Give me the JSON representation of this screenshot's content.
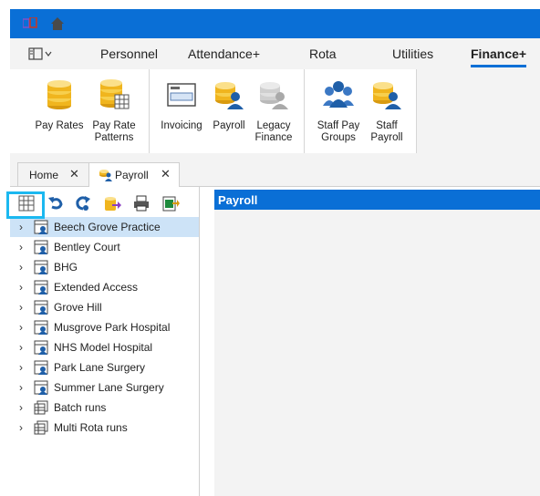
{
  "menu": {
    "tabs": [
      {
        "label": "Personnel"
      },
      {
        "label": "Attendance+"
      },
      {
        "label": "Rota"
      },
      {
        "label": "Utilities"
      },
      {
        "label": "Finance+"
      }
    ],
    "active": "Finance+"
  },
  "ribbon": {
    "buttons": [
      {
        "label": "Pay Rates",
        "icon": "coins-icon"
      },
      {
        "label": "Pay Rate Patterns",
        "icon": "coins-table-icon"
      },
      {
        "label": "Invoicing",
        "icon": "invoice-icon"
      },
      {
        "label": "Payroll",
        "icon": "payroll-icon"
      },
      {
        "label": "Legacy Finance",
        "icon": "legacy-finance-icon"
      },
      {
        "label": "Staff Pay Groups",
        "icon": "group-icon"
      },
      {
        "label": "Staff Payroll",
        "icon": "staff-payroll-icon"
      }
    ]
  },
  "doc_tabs": [
    {
      "label": "Home",
      "close": "✕"
    },
    {
      "label": "Payroll",
      "close": "✕"
    }
  ],
  "tree": {
    "items": [
      {
        "label": "Beech Grove Practice",
        "type": "site"
      },
      {
        "label": "Bentley Court",
        "type": "site"
      },
      {
        "label": "BHG",
        "type": "site"
      },
      {
        "label": "Extended Access",
        "type": "site"
      },
      {
        "label": "Grove Hill",
        "type": "site"
      },
      {
        "label": "Musgrove Park Hospital",
        "type": "site"
      },
      {
        "label": "NHS Model Hospital",
        "type": "site"
      },
      {
        "label": "Park Lane Surgery",
        "type": "site"
      },
      {
        "label": "Summer Lane Surgery",
        "type": "site"
      },
      {
        "label": "Batch runs",
        "type": "runs"
      },
      {
        "label": "Multi Rota runs",
        "type": "runs"
      }
    ],
    "selected": "Beech Grove Practice"
  },
  "panel": {
    "title": "Payroll"
  },
  "colors": {
    "accent": "#0a6fd6",
    "highlight": "#1bb8f0",
    "selected_row": "#cde3f7"
  }
}
